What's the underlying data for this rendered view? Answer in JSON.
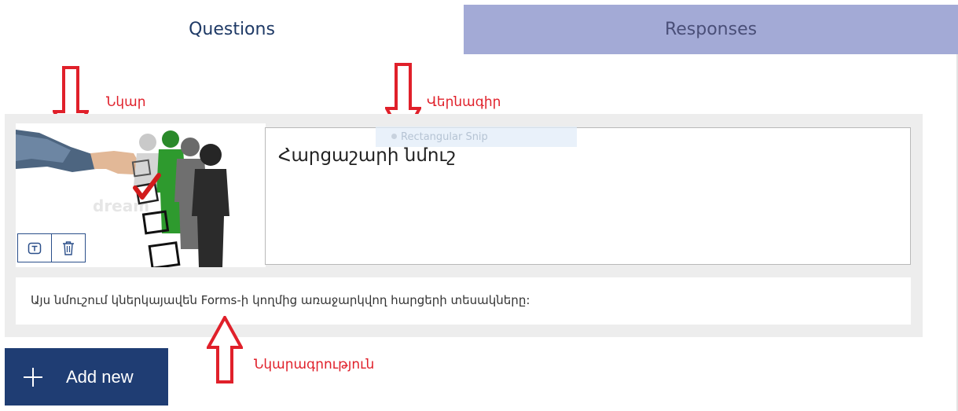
{
  "tabs": {
    "questions": "Questions",
    "responses": "Responses"
  },
  "card": {
    "title": "Հարցաշարի նմուշ",
    "description": "Այս նմուշում կներկայավեն Forms-ի կողմից առաջարկվող հարցերի տեսակները:",
    "image_watermark": "dream",
    "snip_overlay": "Rectangular Snip"
  },
  "image_tools": {
    "text_icon": "text-box-icon",
    "delete_icon": "trash-icon"
  },
  "add_button": {
    "label": "Add new",
    "icon": "plus-icon"
  },
  "annotations": {
    "image_label": "Նկար",
    "title_label": "Վերնագիր",
    "description_label": "Նկարագրություն"
  },
  "colors": {
    "tab_active_text": "#1f3a66",
    "tab_inactive_bg": "#a3aad6",
    "primary_button": "#1f3d73",
    "annotation_red": "#e0202a",
    "card_bg": "#ededed"
  }
}
